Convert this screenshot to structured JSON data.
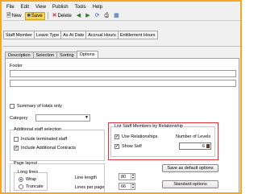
{
  "menu": [
    "File",
    "Edit",
    "View",
    "Publish",
    "Tools",
    "Help"
  ],
  "toolbar": {
    "new_label": "New",
    "save_label": "Save",
    "delete_label": "Delete"
  },
  "field_tabs": [
    "Staff Member",
    "Leave Type",
    "As At Date",
    "Accrual Hours",
    "Entitlement Hours"
  ],
  "tabs": [
    "Description",
    "Selection",
    "Sorting",
    "Options"
  ],
  "selected_tab": "Options",
  "options": {
    "footer_label": "Footer",
    "summary_label": "Summary of totals only",
    "summary_checked": false,
    "category_label": "Category",
    "category_value": "",
    "additional_staff": {
      "title": "Additional staff selection",
      "include_terminated_label": "Include terminated staff",
      "include_terminated_checked": false,
      "include_contracts_label": "Include Additional Contracts",
      "include_contracts_checked": true
    },
    "list_staff": {
      "title": "List Staff Members by Relationship",
      "use_relationships_label": "Use Relationships",
      "use_relationships_checked": true,
      "show_self_label": "Show Self",
      "show_self_checked": true,
      "number_of_levels_label": "Number of Levels",
      "number_of_levels_value": "6"
    },
    "page_layout": {
      "title": "Page layout",
      "long_lines_label": "Long lines",
      "wrap_label": "Wrap",
      "wrap_selected": true,
      "truncate_label": "Truncate",
      "truncate_selected": false,
      "line_length_label": "Line length",
      "line_length_value": "80",
      "lines_per_page_label": "Lines per page",
      "lines_per_page_value": "66"
    },
    "save_default_label": "Save as default options",
    "standard_options_label": "Standard options"
  },
  "colors": {
    "frame_border": "#f5a623",
    "highlight_border": "#e0303a",
    "save_button_bg": "#f7d35c"
  }
}
